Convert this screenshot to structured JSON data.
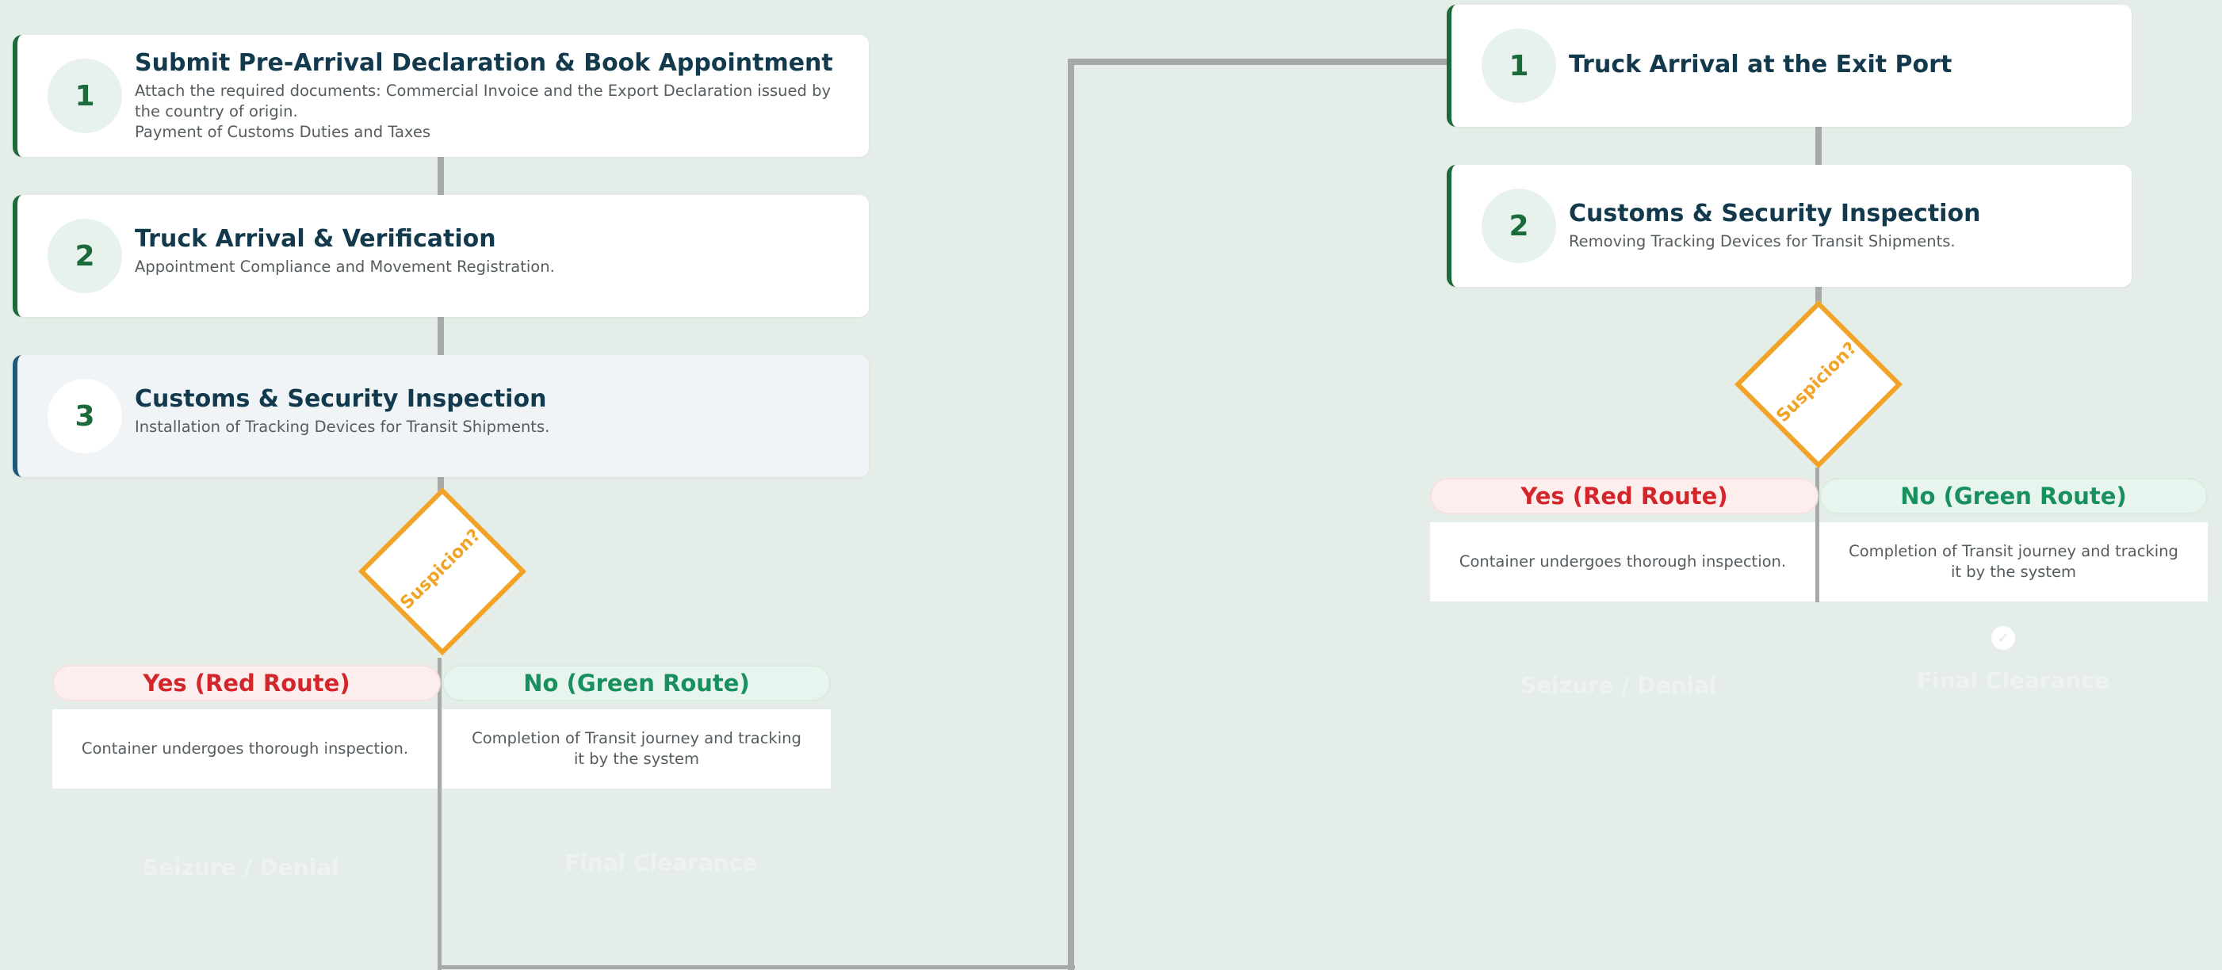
{
  "colors": {
    "background": "#e5ede8",
    "step_accent": "#1b6b3a",
    "active_accent": "#1d5a7a",
    "title": "#123a4c",
    "decision": "#f0a326",
    "red_route": "#d3262a",
    "green_route": "#17905d",
    "connector": "#a6aba7"
  },
  "entry_flow": {
    "steps": [
      {
        "number": "1",
        "title": "Submit Pre-Arrival Declaration & Book Appointment",
        "description": "Attach the required documents: Commercial Invoice and the Export Declaration issued by\nthe country of origin.\nPayment of Customs Duties and Taxes"
      },
      {
        "number": "2",
        "title": "Truck Arrival & Verification",
        "description": "Appointment Compliance and Movement Registration."
      },
      {
        "number": "3",
        "title": "Customs & Security Inspection",
        "description": "Installation of Tracking Devices for Transit Shipments."
      }
    ],
    "decision": "Suspicion?",
    "yes_label": "Yes (Red Route)",
    "no_label": "No (Green Route)",
    "yes_outcome": "Container undergoes thorough inspection.",
    "no_outcome": "Completion of Transit journey and tracking\nit by the system",
    "yes_result": "Seizure / Denial",
    "no_result": "Final Clearance"
  },
  "exit_flow": {
    "steps": [
      {
        "number": "1",
        "title": "Truck Arrival at the Exit Port",
        "description": ""
      },
      {
        "number": "2",
        "title": "Customs & Security Inspection",
        "description": "Removing Tracking Devices for Transit Shipments."
      }
    ],
    "decision": "Suspicion?",
    "yes_label": "Yes (Red Route)",
    "no_label": "No (Green Route)",
    "yes_outcome": "Container undergoes thorough inspection.",
    "no_outcome": "Completion of Transit journey and tracking\nit by the system",
    "yes_result": "Seizure / Denial",
    "no_result": "Final Clearance",
    "check_icon": "check-icon"
  }
}
